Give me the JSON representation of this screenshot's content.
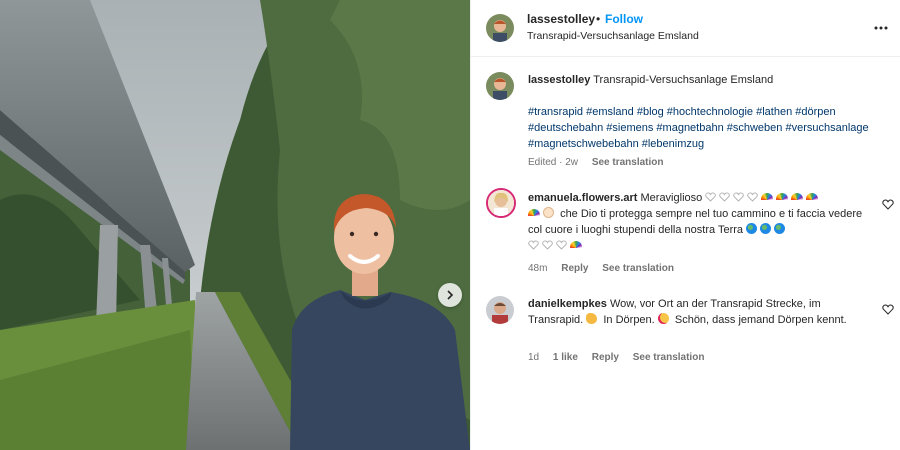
{
  "post": {
    "username": "lassestolley",
    "separator": "•",
    "follow_label": "Follow",
    "location": "Transrapid-Versuchsanlage Emsland"
  },
  "caption": {
    "username": "lassestolley",
    "text": "Transrapid-Versuchsanlage Emsland",
    "hashtags": "#transrapid #emsland #blog #hochtechnologie #lathen #dörpen #deutschebahn #siemens #magnetbahn #schweben #versuchsanlage #magnetschwebebahn #lebenimzug",
    "edited": "Edited · 2w",
    "see_translation": "See translation"
  },
  "comments": [
    {
      "username": "emanuela.flowers.art",
      "text_a": "Meraviglioso",
      "text_b": "che Dio ti protegga sempre nel tuo cammino e ti faccia vedere col cuore i luoghi stupendi della nostra Terra",
      "time": "48m",
      "reply": "Reply",
      "see_translation": "See translation"
    },
    {
      "username": "danielkempkes",
      "text_a": "Wow, vor Ort an der Transrapid Strecke, im Transrapid.",
      "text_b": "In Dörpen.",
      "text_c": "Schön, dass jemand Dörpen kennt.",
      "time": "1d",
      "likes": "1 like",
      "reply": "Reply",
      "see_translation": "See translation"
    }
  ],
  "icons": {
    "more": "more-horizontal-icon",
    "next": "chevron-right-icon",
    "like": "heart-outline-icon"
  },
  "colors": {
    "follow_blue": "#0095f6",
    "hashtag_blue": "#00376b",
    "muted": "#737373"
  }
}
